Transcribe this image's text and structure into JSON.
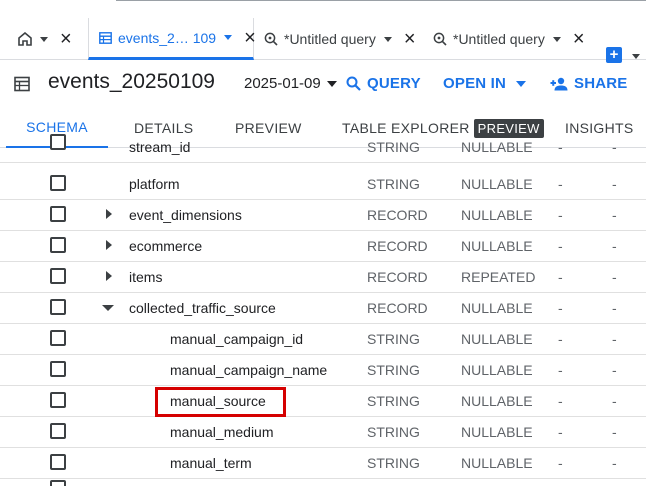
{
  "tabs": [
    {
      "label": "",
      "icon": "home-icon",
      "active": false
    },
    {
      "label": "events_2… 109",
      "icon": "table-icon",
      "active": true
    },
    {
      "label": "*Untitled query",
      "icon": "query-icon",
      "active": false
    },
    {
      "label": "*Untitled query",
      "icon": "query-icon",
      "active": false
    }
  ],
  "header": {
    "title": "events_20250109",
    "date": "2025-01-09",
    "query_label": "QUERY",
    "open_in_label": "OPEN IN",
    "share_label": "SHARE"
  },
  "subtabs": {
    "schema": "SCHEMA",
    "details": "DETAILS",
    "preview": "PREVIEW",
    "table_explorer": "TABLE EXPLORER",
    "table_explorer_badge": "PREVIEW",
    "insights": "INSIGHTS"
  },
  "rows": [
    {
      "name": "stream_id",
      "type": "STRING",
      "mode": "NULLABLE",
      "d1": "-",
      "d2": "-",
      "indent": 1,
      "expander": "none"
    },
    {
      "name": "platform",
      "type": "STRING",
      "mode": "NULLABLE",
      "d1": "-",
      "d2": "-",
      "indent": 1,
      "expander": "none"
    },
    {
      "name": "event_dimensions",
      "type": "RECORD",
      "mode": "NULLABLE",
      "d1": "-",
      "d2": "-",
      "indent": 1,
      "expander": "right"
    },
    {
      "name": "ecommerce",
      "type": "RECORD",
      "mode": "NULLABLE",
      "d1": "-",
      "d2": "-",
      "indent": 1,
      "expander": "right"
    },
    {
      "name": "items",
      "type": "RECORD",
      "mode": "REPEATED",
      "d1": "-",
      "d2": "-",
      "indent": 1,
      "expander": "right"
    },
    {
      "name": "collected_traffic_source",
      "type": "RECORD",
      "mode": "NULLABLE",
      "d1": "-",
      "d2": "-",
      "indent": 1,
      "expander": "down"
    },
    {
      "name": "manual_campaign_id",
      "type": "STRING",
      "mode": "NULLABLE",
      "d1": "-",
      "d2": "-",
      "indent": 2,
      "expander": "none"
    },
    {
      "name": "manual_campaign_name",
      "type": "STRING",
      "mode": "NULLABLE",
      "d1": "-",
      "d2": "-",
      "indent": 2,
      "expander": "none"
    },
    {
      "name": "manual_source",
      "type": "STRING",
      "mode": "NULLABLE",
      "d1": "-",
      "d2": "-",
      "indent": 2,
      "expander": "none",
      "highlighted": true
    },
    {
      "name": "manual_medium",
      "type": "STRING",
      "mode": "NULLABLE",
      "d1": "-",
      "d2": "-",
      "indent": 2,
      "expander": "none"
    },
    {
      "name": "manual_term",
      "type": "STRING",
      "mode": "NULLABLE",
      "d1": "-",
      "d2": "-",
      "indent": 2,
      "expander": "none"
    }
  ],
  "colors": {
    "accent": "#1a73e8",
    "highlight": "#d50000",
    "text": "#202124",
    "muted": "#5f6368"
  }
}
